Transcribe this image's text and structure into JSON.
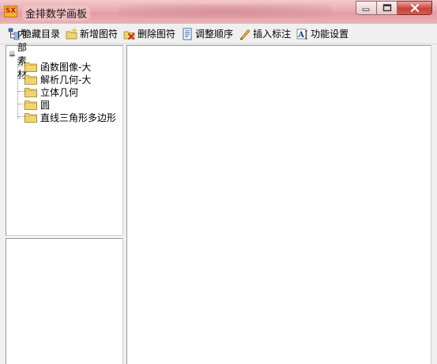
{
  "window": {
    "title": "金排数学画板",
    "app_icon_text": "SX",
    "buttons": [
      "minimize-icon",
      "maximize-icon",
      "close-icon"
    ]
  },
  "toolbar": {
    "items": [
      {
        "label": "隐藏目录",
        "icon": "tree-view-icon"
      },
      {
        "label": "新增图符",
        "icon": "new-folder-icon"
      },
      {
        "label": "删除图符",
        "icon": "delete-icon"
      },
      {
        "label": "调整顺序",
        "icon": "document-icon"
      },
      {
        "label": "插入标注",
        "icon": "pencil-icon"
      },
      {
        "label": "功能设置",
        "icon": "text-settings-icon"
      }
    ]
  },
  "tree": {
    "root": {
      "label": "内部素材",
      "icon": "document-root-icon"
    },
    "items": [
      {
        "label": "函数图像-大",
        "icon": "folder-icon"
      },
      {
        "label": "解析几何-大",
        "icon": "folder-icon"
      },
      {
        "label": "立体几何",
        "icon": "folder-icon"
      },
      {
        "label": "圆",
        "icon": "folder-icon"
      },
      {
        "label": "直线三角形多边形",
        "icon": "folder-icon"
      }
    ]
  },
  "colors": {
    "titlebar": "#e9a9ad",
    "window_bg": "#f0f0f0",
    "folder": "#f2d46e",
    "close_button": "#c7433a"
  }
}
